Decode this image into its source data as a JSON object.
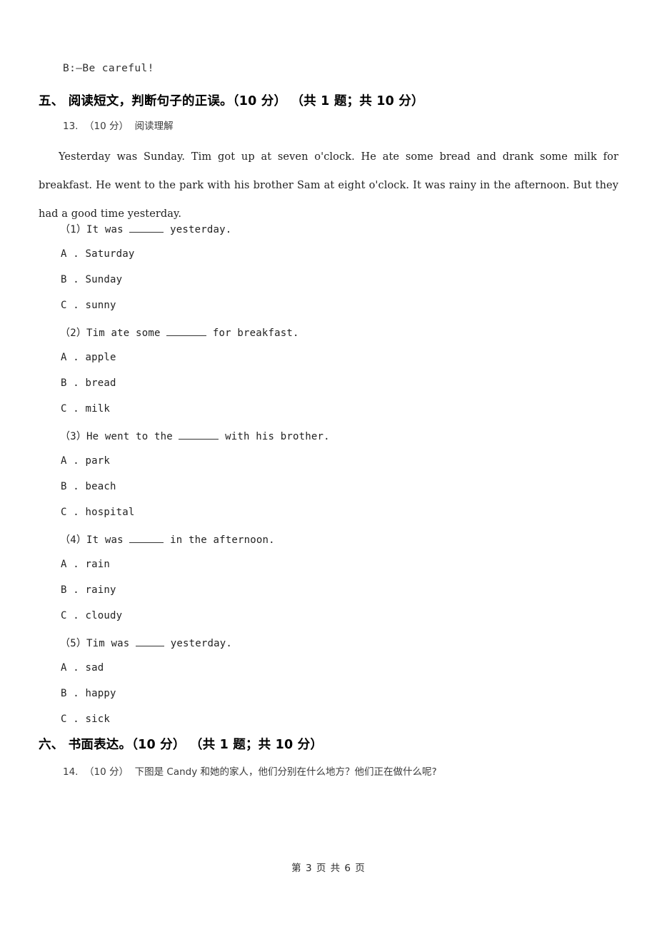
{
  "document": {
    "page_footer": "第 3 页 共 6 页",
    "previous_line": "B:—Be careful!"
  },
  "sections": [
    {
      "heading": "五、 阅读短文，判断句子的正误。（10 分） （共 1 题；共 10 分）",
      "item_number": "13.",
      "item_score": "（10 分）",
      "item_title": "阅读理解",
      "item_head_line": "13.  （10 分）  阅读理解",
      "passage": "Yesterday was Sunday. Tim got up at seven o'clock. He ate some bread and drank some milk for breakfast. He went to the park with his brother Sam at eight o'clock. It was rainy in the afternoon. But they had a good time yesterday.",
      "questions": [
        {
          "number": "（1）",
          "stem_before": "It was ",
          "stem_after": " yesterday.",
          "blank_width": "blank-5",
          "options": [
            {
              "letter": "A",
              "text": "Saturday",
              "line": "A . Saturday"
            },
            {
              "letter": "B",
              "text": "Sunday",
              "line": "B . Sunday"
            },
            {
              "letter": "C",
              "text": "sunny",
              "line": "C . sunny"
            }
          ]
        },
        {
          "number": "（2）",
          "stem_before": "Tim ate some ",
          "stem_after": " for breakfast.",
          "blank_width": "blank-6",
          "options": [
            {
              "letter": "A",
              "text": "apple",
              "line": "A . apple"
            },
            {
              "letter": "B",
              "text": "bread",
              "line": "B . bread"
            },
            {
              "letter": "C",
              "text": "milk",
              "line": "C . milk"
            }
          ]
        },
        {
          "number": "（3）",
          "stem_before": "He went to the ",
          "stem_after": " with his brother.",
          "blank_width": "blank-6",
          "options": [
            {
              "letter": "A",
              "text": "park",
              "line": "A . park"
            },
            {
              "letter": "B",
              "text": "beach",
              "line": "B . beach"
            },
            {
              "letter": "C",
              "text": "hospital",
              "line": "C . hospital"
            }
          ]
        },
        {
          "number": "（4）",
          "stem_before": "It was ",
          "stem_after": " in the afternoon.",
          "blank_width": "blank-5",
          "options": [
            {
              "letter": "A",
              "text": "rain",
              "line": "A . rain"
            },
            {
              "letter": "B",
              "text": "rainy",
              "line": "B . rainy"
            },
            {
              "letter": "C",
              "text": "cloudy",
              "line": "C . cloudy"
            }
          ]
        },
        {
          "number": "（5）",
          "stem_before": "Tim was ",
          "stem_after": " yesterday.",
          "blank_width": "blank-4",
          "options": [
            {
              "letter": "A",
              "text": "sad",
              "line": "A . sad"
            },
            {
              "letter": "B",
              "text": "happy",
              "line": "B . happy"
            },
            {
              "letter": "C",
              "text": "sick",
              "line": "C . sick"
            }
          ]
        }
      ]
    },
    {
      "heading": "六、 书面表达。（10 分） （共 1 题；共 10 分）",
      "item_number": "14.",
      "item_score": "（10 分）",
      "item_head_line": "14.  （10 分）  下图是 Candy 和她的家人，他们分别在什么地方？他们正在做什么呢?"
    }
  ]
}
